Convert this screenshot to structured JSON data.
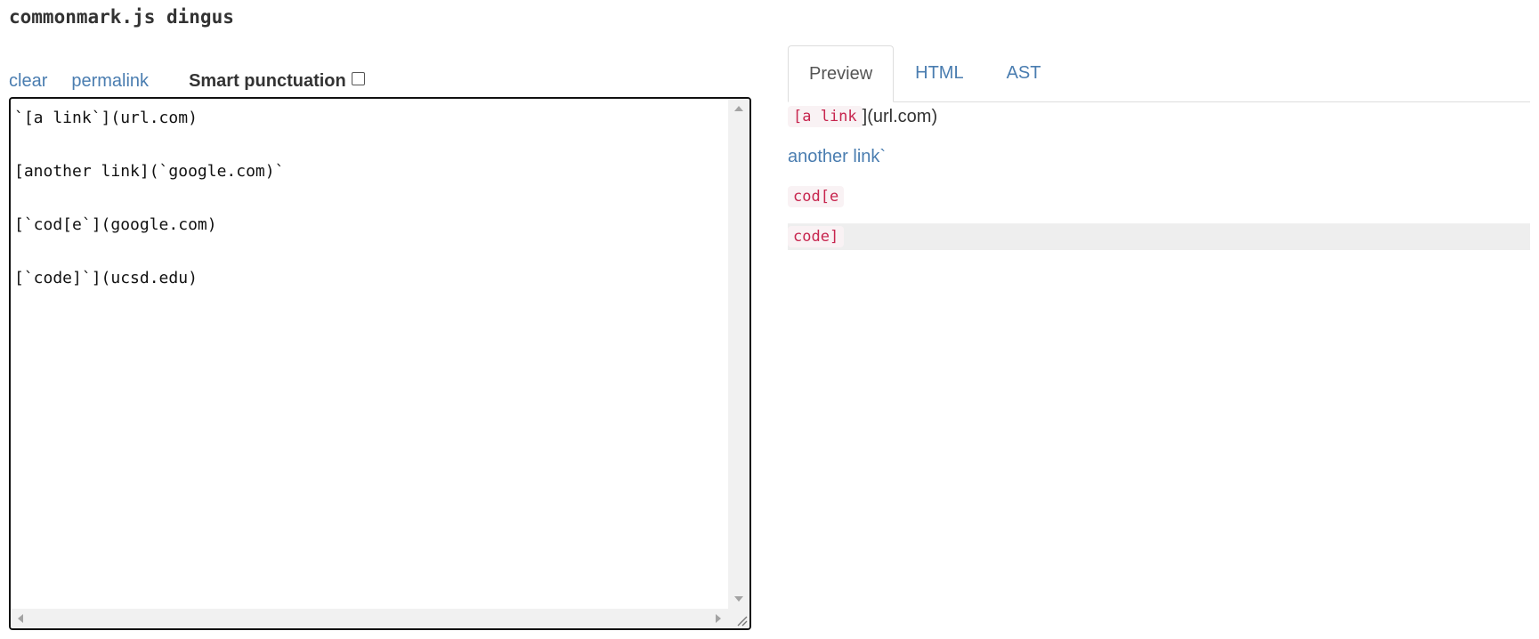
{
  "app": {
    "title": "commonmark.js dingus"
  },
  "controls": {
    "clear_label": "clear",
    "permalink_label": "permalink",
    "smart_punctuation_label": "Smart punctuation",
    "smart_punctuation_checked": false
  },
  "editor": {
    "content": "`[a link`](url.com)\n\n[another link](`google.com)`\n\n[`cod[e`](google.com)\n\n[`code]`](ucsd.edu)"
  },
  "tabs": [
    {
      "label": "Preview",
      "active": true
    },
    {
      "label": "HTML",
      "active": false
    },
    {
      "label": "AST",
      "active": false
    }
  ],
  "preview": {
    "line1": {
      "code": "[a link",
      "text": "](url.com)"
    },
    "line2": {
      "link_text": "another link`"
    },
    "line3": {
      "code": "cod[e"
    },
    "line4": {
      "code": "code]"
    }
  },
  "colors": {
    "link": "#4a7db0",
    "code_text": "#c7254e",
    "code_bg": "#f9f2f4",
    "hover_row": "#eeeeee"
  },
  "icons": {
    "scroll_up": "triangle-up",
    "scroll_down": "triangle-down",
    "scroll_left": "triangle-left",
    "scroll_right": "triangle-right",
    "resize": "resize-grip"
  }
}
